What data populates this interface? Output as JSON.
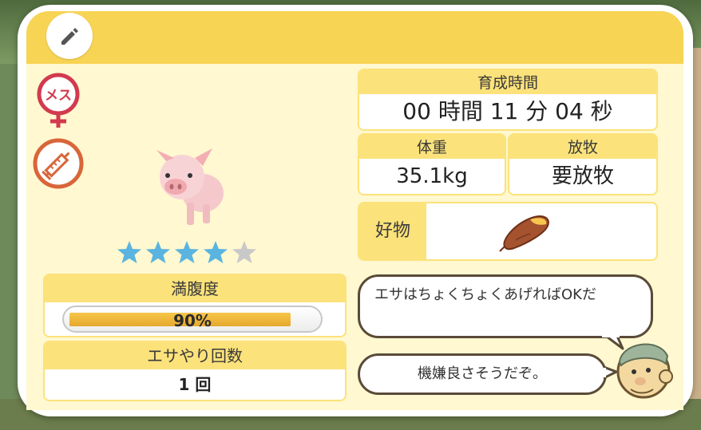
{
  "header": {
    "edit_icon": "pencil-icon"
  },
  "pet": {
    "gender_badge": "メス",
    "gender_icon": "female-symbol-icon",
    "vaccine_icon": "syringe-icon",
    "stars_filled": 4,
    "stars_total": 5
  },
  "stats": {
    "satiety_label": "満腹度",
    "satiety_value": "90%",
    "satiety_fraction": 0.9,
    "feed_count_label": "エサやり回数",
    "feed_count_value": "1 回",
    "raising_time_label": "育成時間",
    "raising_time_value": "00 時間 11 分 04 秒",
    "weight_label": "体重",
    "weight_value": "35.1kg",
    "grazing_label": "放牧",
    "grazing_value": "要放牧",
    "favorite_label": "好物",
    "favorite_icon": "sweet-potato-icon"
  },
  "dialogue": {
    "advice": "エサはちょくちょくあげればOKだ",
    "mood": "機嫌良さそうだぞ。"
  },
  "colors": {
    "header": "#f8d454",
    "panel_bg": "#fff8d0",
    "star_filled": "#5bb4e0",
    "star_empty": "#c8c8c8",
    "badge_red": "#d23a4e",
    "badge_orange": "#d8663a"
  }
}
